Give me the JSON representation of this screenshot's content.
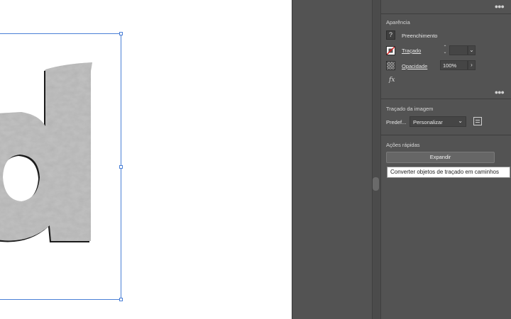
{
  "panel": {
    "appearance": {
      "title": "Aparência",
      "fill_label": "Preenchimento",
      "stroke_label": "Traçado",
      "opacity_label": "Opacidade",
      "opacity_value": "100%",
      "fx_label": "fx"
    },
    "image_trace": {
      "title": "Traçado da imagem",
      "preset_label": "Predef...",
      "preset_value": "Personalizar"
    },
    "quick_actions": {
      "title": "Ações rápidas",
      "expand_label": "Expandir",
      "tooltip": "Converter objetos de traçado em caminhos"
    }
  },
  "colors": {
    "selection": "#4a7fd6",
    "panel_bg": "#535353",
    "canvas_bg": "#ffffff"
  },
  "icons": [
    "unknown-fill-icon",
    "stroke-none-icon",
    "stepper-icon",
    "chevron-down-icon",
    "checkerboard-icon",
    "chevron-right-icon",
    "fx-icon",
    "more-options-icon",
    "trace-options-icon"
  ]
}
